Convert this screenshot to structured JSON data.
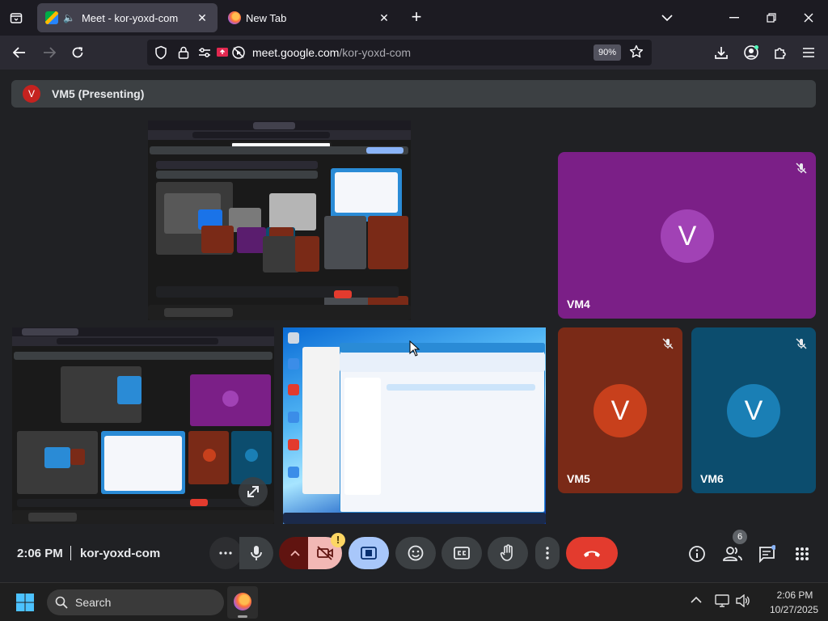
{
  "browser": {
    "tabs": [
      {
        "title": "Meet - kor-yoxd-com",
        "active": true,
        "audio": true
      },
      {
        "title": "New Tab",
        "active": false
      }
    ],
    "url_domain": "meet.google.com",
    "url_path": "/kor-yoxd-com",
    "zoom": "90%"
  },
  "meet": {
    "presenter": {
      "initial": "V",
      "label": "VM5 (Presenting)"
    },
    "participants": [
      {
        "name": "VM4",
        "initial": "V",
        "bg": "#7b1f87",
        "avatar": "#a142b5",
        "muted": true
      },
      {
        "name": "VM5",
        "initial": "V",
        "bg": "#7a2a17",
        "avatar": "#c8401c",
        "muted": true
      },
      {
        "name": "VM6",
        "initial": "V",
        "bg": "#0c4d6e",
        "avatar": "#1a7fb5",
        "muted": true
      }
    ],
    "time": "2:06 PM",
    "code": "kor-yoxd-com",
    "people_count": "6"
  },
  "taskbar": {
    "search_placeholder": "Search",
    "clock_time": "2:06 PM",
    "clock_date": "10/27/2025"
  },
  "colors": {
    "end_call": "#e33b2e",
    "camera_off": "#f2b8b5",
    "present_active": "#a8c7fa",
    "more_dark_red": "#601410"
  }
}
